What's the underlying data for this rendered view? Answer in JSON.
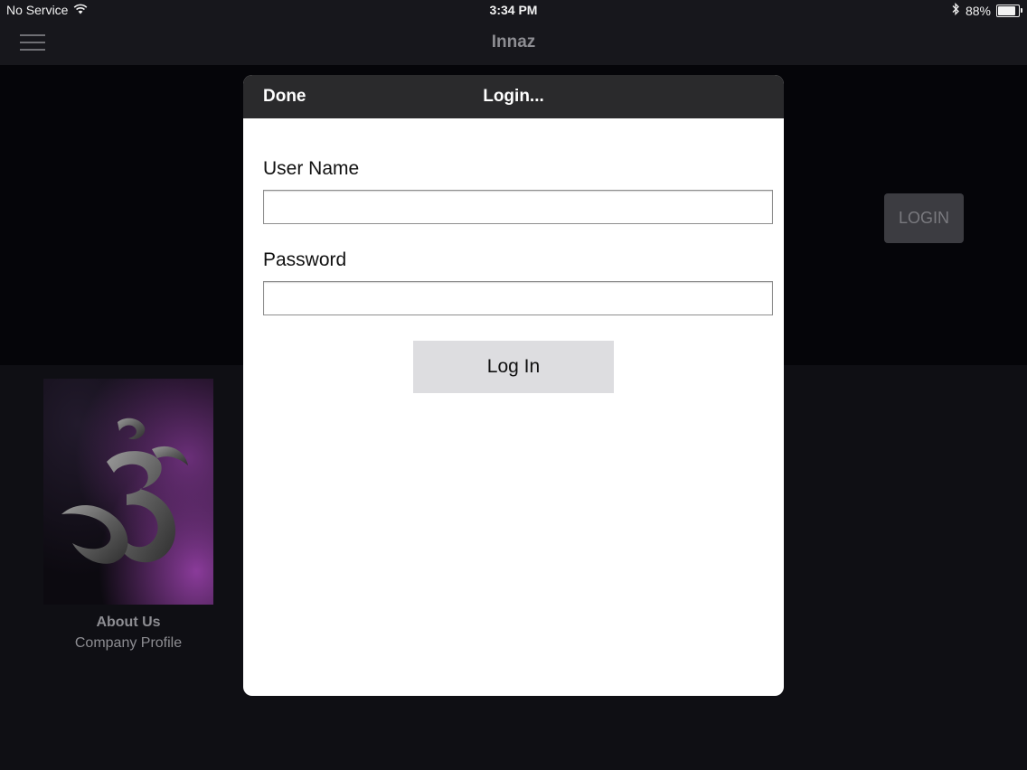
{
  "status_bar": {
    "carrier": "No Service",
    "time": "3:34 PM",
    "battery": "88%",
    "battery_level": 0.88,
    "icons": [
      "wifi-icon",
      "bluetooth-icon",
      "battery-icon"
    ]
  },
  "nav": {
    "title": "Innaz",
    "menu_icon": "hamburger-menu-icon"
  },
  "background": {
    "login_button": "LOGIN",
    "card": {
      "title": "About Us",
      "subtitle": "Company Profile",
      "image": "om-symbol-logo"
    }
  },
  "modal": {
    "done_label": "Done",
    "title": "Login...",
    "username_label": "User Name",
    "username_value": "",
    "password_label": "Password",
    "password_value": "",
    "submit_label": "Log In"
  },
  "colors": {
    "background": "#0f0f13",
    "modal_header": "#2a2a2c",
    "button_gray": "#dddde0",
    "accent_purple": "#8a3b9a"
  }
}
